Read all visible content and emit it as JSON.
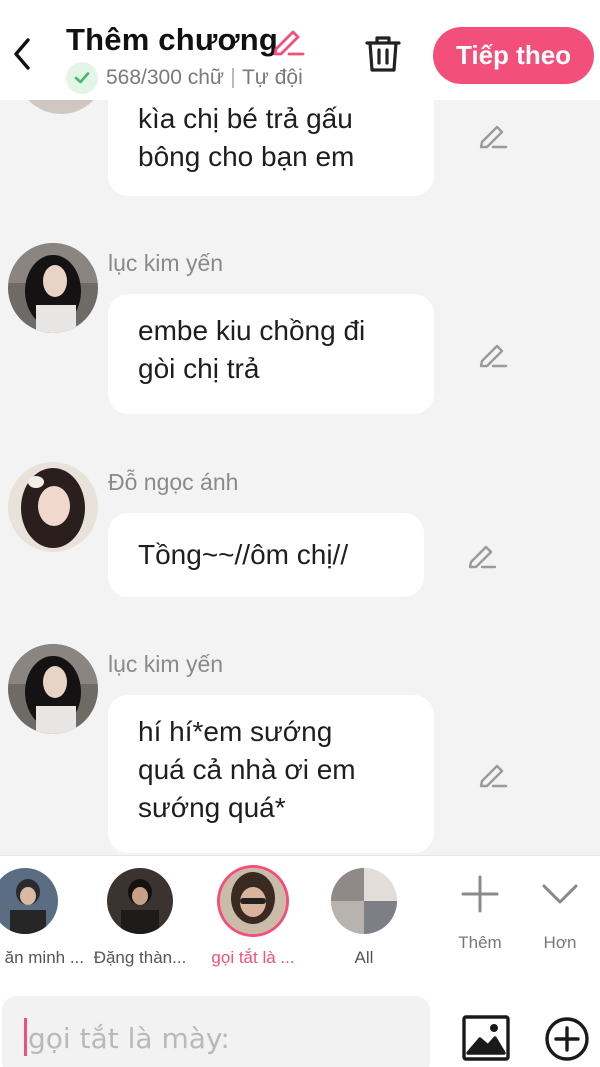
{
  "header": {
    "title": "Thêm chương",
    "word_count": "568/300 chữ",
    "mode": "Tự đội",
    "next_label": "Tiếp theo"
  },
  "messages": [
    {
      "sender": "",
      "lines": [
        "kìa chị bé trả gấu",
        "bông cho bạn em"
      ],
      "avatar": "avatar-a"
    },
    {
      "sender": "lục kim yến",
      "lines": [
        "embe kiu chồng đi",
        "gòi chị trả"
      ],
      "avatar": "avatar-b"
    },
    {
      "sender": "Đỗ ngọc ánh",
      "lines": [
        "Tồng~~//ôm chị//"
      ],
      "avatar": "avatar-c"
    },
    {
      "sender": "lục kim yến",
      "lines": [
        "hí hí*em sướng",
        "quá cả nhà ơi em",
        "sướng quá*"
      ],
      "avatar": "avatar-b"
    }
  ],
  "characters": [
    {
      "name": "ăn minh ...",
      "selected": false
    },
    {
      "name": "Đặng thàn...",
      "selected": false
    },
    {
      "name": "gọi tắt là ...",
      "selected": true
    },
    {
      "name": "All",
      "selected": false
    }
  ],
  "tools": {
    "add_label": "Thêm",
    "more_label": "Hơn"
  },
  "input": {
    "placeholder": "gọi tắt là mày:"
  },
  "colors": {
    "accent": "#f2507a",
    "check_green": "#3fbf5f",
    "background": "#f3f3f3"
  },
  "icons": [
    "back-arrow-icon",
    "pencil-icon",
    "check-icon",
    "trash-icon",
    "edit-icon",
    "plus-icon",
    "chevron-down-icon",
    "image-icon",
    "add-circle-icon"
  ]
}
